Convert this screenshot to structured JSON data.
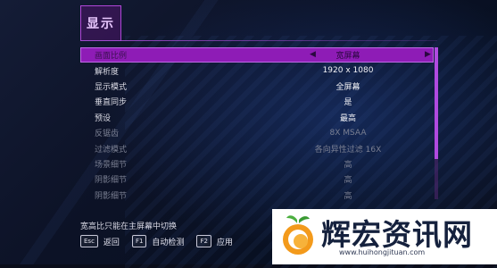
{
  "panel": {
    "title": "显示"
  },
  "settings": [
    {
      "label": "画面比例",
      "value": "宽屏幕",
      "selected": true,
      "dim": false
    },
    {
      "label": "解析度",
      "value": "1920 x 1080",
      "selected": false,
      "dim": false
    },
    {
      "label": "显示模式",
      "value": "全屏幕",
      "selected": false,
      "dim": false
    },
    {
      "label": "垂直同步",
      "value": "是",
      "selected": false,
      "dim": false
    },
    {
      "label": "预设",
      "value": "最高",
      "selected": false,
      "dim": false
    },
    {
      "label": "反锯齿",
      "value": "8X MSAA",
      "selected": false,
      "dim": true
    },
    {
      "label": "过滤模式",
      "value": "各向异性过滤 16X",
      "selected": false,
      "dim": true
    },
    {
      "label": "场景细节",
      "value": "高",
      "selected": false,
      "dim": true
    },
    {
      "label": "阴影细节",
      "value": "高",
      "selected": false,
      "dim": true
    },
    {
      "label": "阴影细节",
      "value": "高",
      "selected": false,
      "dim": true
    }
  ],
  "hint": "宽高比只能在主屏幕中切换",
  "footer": {
    "back": {
      "key": "Esc",
      "label": "返回"
    },
    "autodetect": {
      "key": "F1",
      "label": "自动检测"
    },
    "apply": {
      "key": "F2",
      "label": "应用"
    }
  },
  "watermark": {
    "text": "辉宏资讯网",
    "url": "www.huihongjituan.com"
  },
  "colors": {
    "accent": "#8e1cb6",
    "selected_border": "#c06ae6",
    "background": "#0a0d1a"
  },
  "scroll_position": 0
}
